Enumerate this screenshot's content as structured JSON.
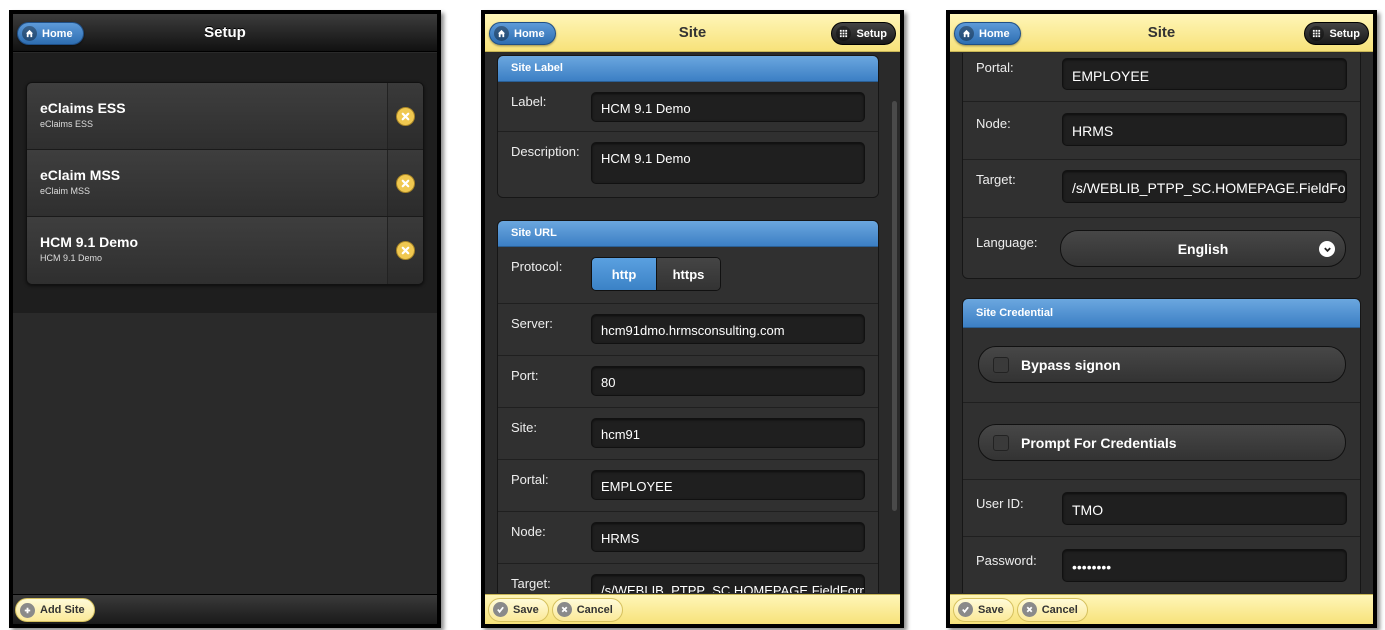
{
  "screens": [
    {
      "title": "Setup",
      "home_label": "Home",
      "sites": [
        {
          "title": "eClaims ESS",
          "subtitle": "eClaims ESS"
        },
        {
          "title": "eClaim MSS",
          "subtitle": "eClaim MSS"
        },
        {
          "title": "HCM 9.1 Demo",
          "subtitle": "HCM 9.1 Demo"
        }
      ],
      "add_label": "Add Site"
    },
    {
      "title": "Site",
      "home_label": "Home",
      "setup_label": "Setup",
      "site_label_section": "Site Label",
      "label_label": "Label:",
      "label_value": "HCM 9.1 Demo",
      "description_label": "Description:",
      "description_value": "HCM 9.1 Demo",
      "site_url_section": "Site URL",
      "protocol_label": "Protocol:",
      "protocol_options": [
        "http",
        "https"
      ],
      "protocol_selected": "http",
      "server_label": "Server:",
      "server_value": "hcm91dmo.hrmsconsulting.com",
      "port_label": "Port:",
      "port_value": "80",
      "site_label": "Site:",
      "site_value": "hcm91",
      "portal_label": "Portal:",
      "portal_value": "EMPLOYEE",
      "node_label": "Node:",
      "node_value": "HRMS",
      "target_label": "Target:",
      "target_value": "/s/WEBLIB_PTPP_SC.HOMEPAGE.FieldFormula",
      "save_label": "Save",
      "cancel_label": "Cancel"
    },
    {
      "title": "Site",
      "home_label": "Home",
      "setup_label": "Setup",
      "portal_label": "Portal:",
      "portal_value": "EMPLOYEE",
      "node_label": "Node:",
      "node_value": "HRMS",
      "target_label": "Target:",
      "target_value": "/s/WEBLIB_PTPP_SC.HOMEPAGE.FieldFormula",
      "language_label": "Language:",
      "language_value": "English",
      "credential_section": "Site Credential",
      "bypass_label": "Bypass signon",
      "bypass_checked": false,
      "prompt_label": "Prompt For Credentials",
      "prompt_checked": false,
      "userid_label": "User ID:",
      "userid_value": "TMO",
      "password_label": "Password:",
      "password_value": "••••••••",
      "save_label": "Save",
      "cancel_label": "Cancel"
    }
  ],
  "colors": {
    "header_dark": "#1a1a1a",
    "header_yellow": "#f7e27a",
    "accent_blue": "#3c7fc4",
    "delete_yellow": "#f0c850"
  },
  "icons": {
    "home": "home-icon",
    "setup": "grid-icon",
    "delete": "close-icon",
    "add": "plus-icon",
    "save": "check-icon",
    "cancel": "close-icon",
    "select": "chevron-down-icon"
  }
}
